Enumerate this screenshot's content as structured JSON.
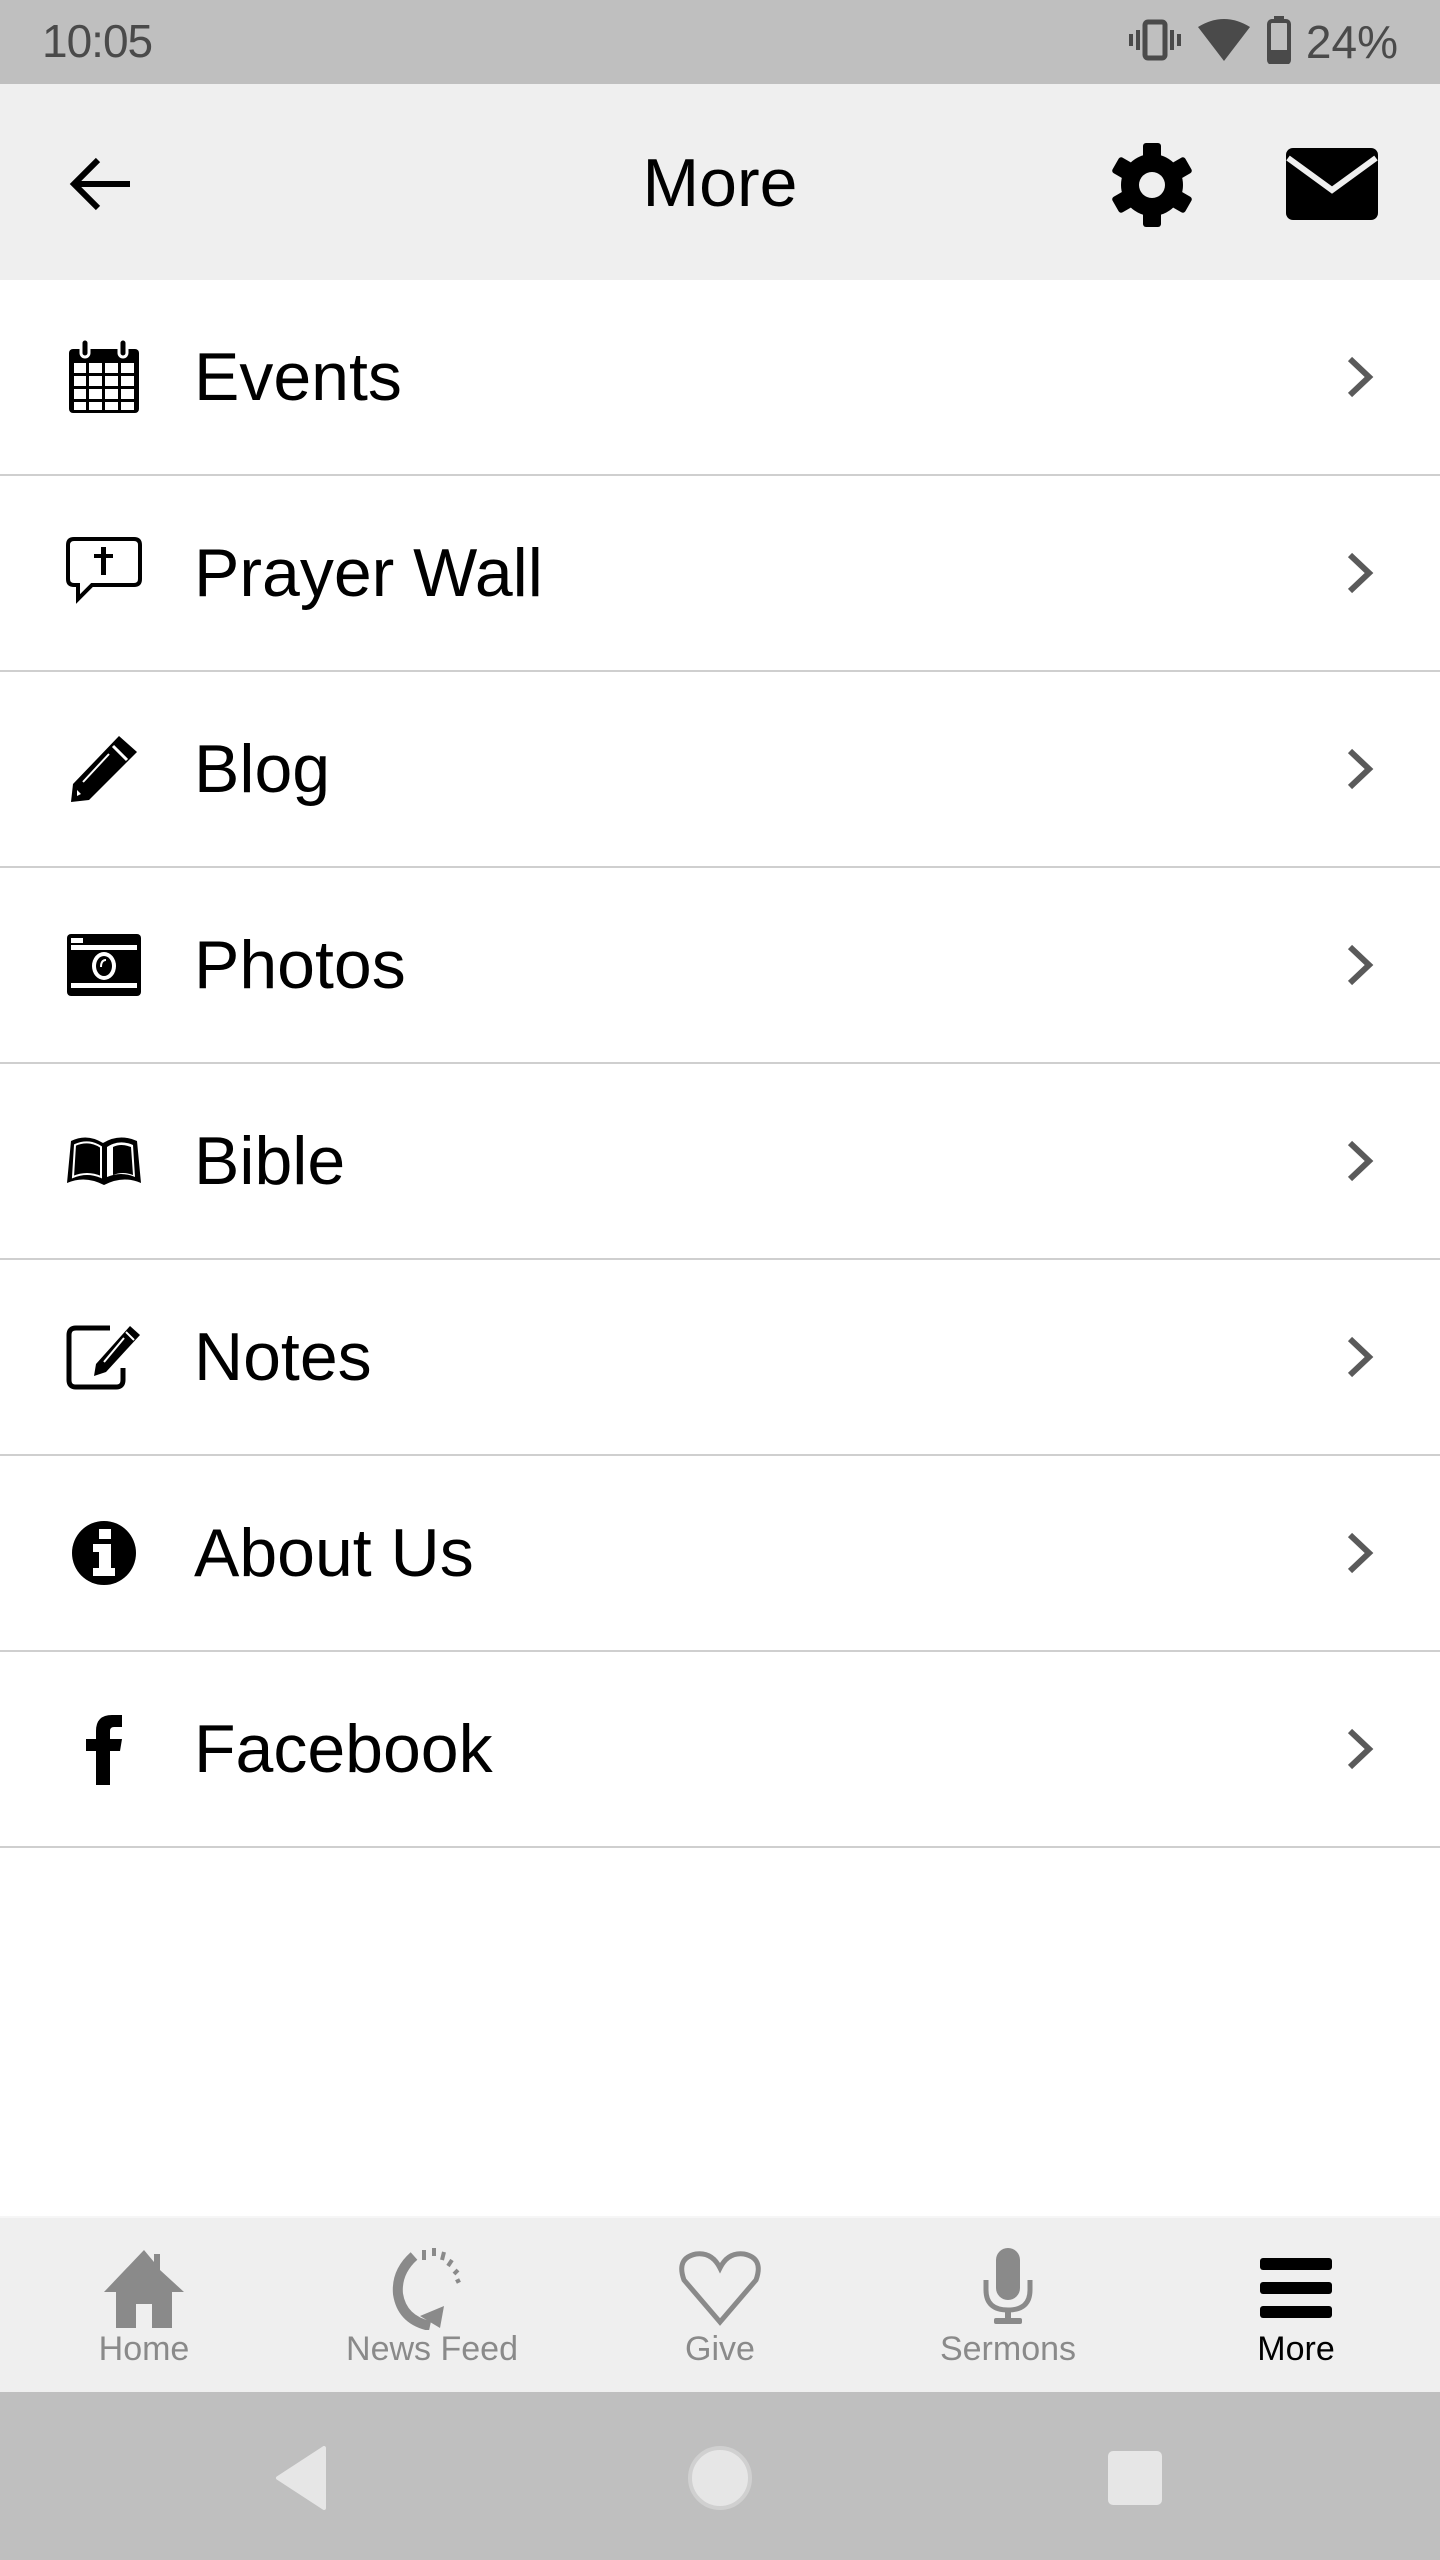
{
  "status_bar": {
    "time": "10:05",
    "battery_percent": "24%",
    "icons": [
      "vibrate-icon",
      "wifi-icon",
      "battery-icon"
    ]
  },
  "app_bar": {
    "title": "More",
    "back_icon": "arrow-left-icon",
    "actions": [
      "gear-icon",
      "envelope-icon"
    ]
  },
  "menu": {
    "items": [
      {
        "label": "Events",
        "icon": "calendar-icon"
      },
      {
        "label": "Prayer Wall",
        "icon": "prayer-bubble-icon"
      },
      {
        "label": "Blog",
        "icon": "pencil-icon"
      },
      {
        "label": "Photos",
        "icon": "camera-icon"
      },
      {
        "label": "Bible",
        "icon": "open-book-icon"
      },
      {
        "label": "Notes",
        "icon": "edit-note-icon"
      },
      {
        "label": "About Us",
        "icon": "info-icon"
      },
      {
        "label": "Facebook",
        "icon": "facebook-icon"
      }
    ],
    "chevron_icon": "chevron-right-icon"
  },
  "bottom_nav": {
    "tabs": [
      {
        "label": "Home",
        "icon": "home-icon",
        "active": false
      },
      {
        "label": "News Feed",
        "icon": "refresh-icon",
        "active": false
      },
      {
        "label": "Give",
        "icon": "heart-icon",
        "active": false
      },
      {
        "label": "Sermons",
        "icon": "microphone-icon",
        "active": false
      },
      {
        "label": "More",
        "icon": "hamburger-menu-icon",
        "active": true
      }
    ]
  },
  "colors": {
    "status_bar_bg": "#bfbfbf",
    "app_bar_bg": "#efefef",
    "divider": "#cfcfcf",
    "inactive_tab": "#8a8a8a",
    "active_tab": "#000000"
  }
}
